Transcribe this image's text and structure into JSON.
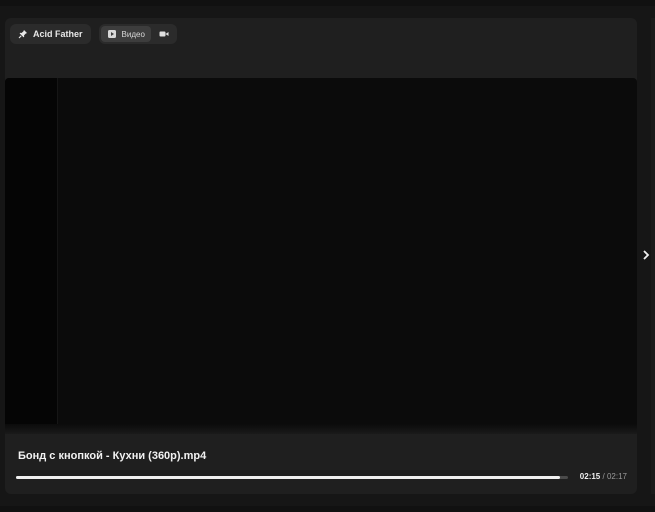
{
  "toolbar": {
    "author_label": "Acid Father",
    "author_icon": "pin-icon",
    "tab_video_label": "Видео",
    "tab_video_icon": "video-file-icon",
    "tab_camera_icon": "camera-icon"
  },
  "player": {
    "title": "Бонд с кнопкой - Кухни (360p).mp4",
    "current_time": "02:15",
    "separator": "/",
    "duration": "02:17",
    "progress": 0.985
  },
  "nav": {
    "next_icon": "chevron-right-icon"
  },
  "colors": {
    "background": "#161616",
    "panel": "#1f1f1f",
    "video": "#0b0b0b",
    "progress_fill": "#f0f0f0"
  }
}
